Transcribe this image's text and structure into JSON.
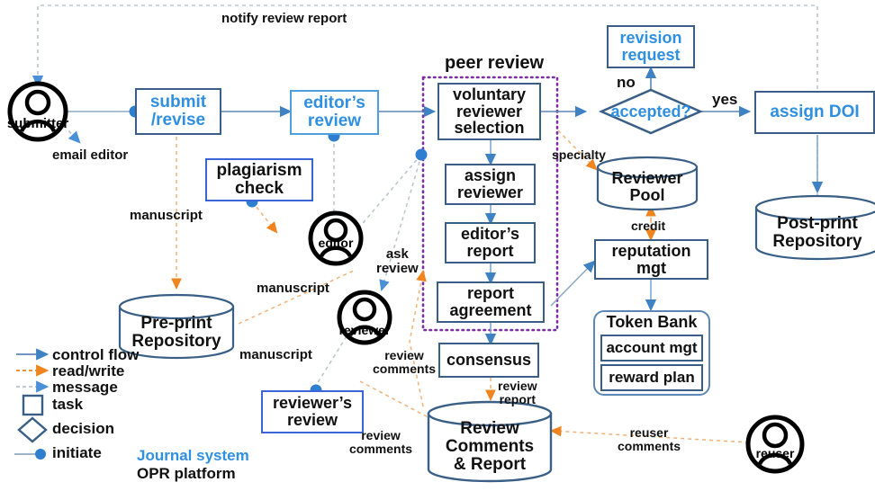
{
  "diagram": {
    "title_peer_review": "peer review",
    "system_legend": {
      "journal_system": "Journal system",
      "opr_platform": "OPR platform",
      "journal_color": "#2f8fe0",
      "opr_color": "#111111"
    }
  },
  "legend": {
    "items": [
      {
        "key": "control-flow",
        "label": "control flow",
        "color": "#5b86b5",
        "style": "solid-arrow"
      },
      {
        "key": "read-write",
        "label": "read/write",
        "color": "#e8821e",
        "style": "dashed-arrow"
      },
      {
        "key": "message",
        "label": "message",
        "color": "#9aa7b5",
        "style": "dashed-arrow-blue"
      },
      {
        "key": "task",
        "label": "task",
        "color": "#3a5f86",
        "style": "rectangle"
      },
      {
        "key": "decision",
        "label": "decision",
        "color": "#3a5f86",
        "style": "diamond"
      },
      {
        "key": "initiate",
        "label": "initiate",
        "color": "#2f7fd0",
        "style": "dot"
      }
    ]
  },
  "actors": [
    {
      "id": "submitter",
      "label": "submitter"
    },
    {
      "id": "editor",
      "label": "editor"
    },
    {
      "id": "reviewer",
      "label": "reviewer"
    },
    {
      "id": "reuser",
      "label": "reuser"
    }
  ],
  "nodes": {
    "submit_revise": "submit\n/revise",
    "editors_review": "editor’s\nreview",
    "plagiarism_check": "plagiarism\ncheck",
    "voluntary_reviewer_selection": "voluntary\nreviewer\nselection",
    "assign_reviewer": "assign\nreviewer",
    "editors_report": "editor’s\nreport",
    "report_agreement": "report\nagreement",
    "consensus": "consensus",
    "reviewers_review": "reviewer’s\nreview",
    "accepted_decision": "accepted?",
    "revision_request": "revision\nrequest",
    "assign_doi": "assign DOI",
    "reputation_mgt": "reputation\nmgt",
    "token_bank": "Token Bank",
    "account_mgt": "account  mgt",
    "reward_plan": "reward  plan",
    "reviewer_pool": "Reviewer\nPool",
    "preprint_repository": "Pre-print\nRepository",
    "postprint_repository": "Post-print\nRepository",
    "review_comments_report": "Review\nComments\n& Report"
  },
  "edge_labels": {
    "notify_review_report": "notify review report",
    "email_editor": "email editor",
    "manuscript_1": "manuscript",
    "manuscript_2": "manuscript",
    "manuscript_3": "manuscript",
    "ask_review": "ask\nreview",
    "specialty": "specialty",
    "credit": "credit",
    "no": "no",
    "yes": "yes",
    "review_comments_1": "review\ncomments",
    "review_comments_2": "review\ncomments",
    "review_report": "review\nreport",
    "reuser_comments": "reuser\ncomments"
  },
  "colors": {
    "control_flow": "#5b86b5",
    "read_write": "#e8821e",
    "message": "#b9c3cd",
    "node_border": "#3a5f86",
    "journal_blue": "#2f8fe0",
    "peer_review_boundary": "#7b2fa0",
    "initiate_dot": "#2f7fd0"
  }
}
